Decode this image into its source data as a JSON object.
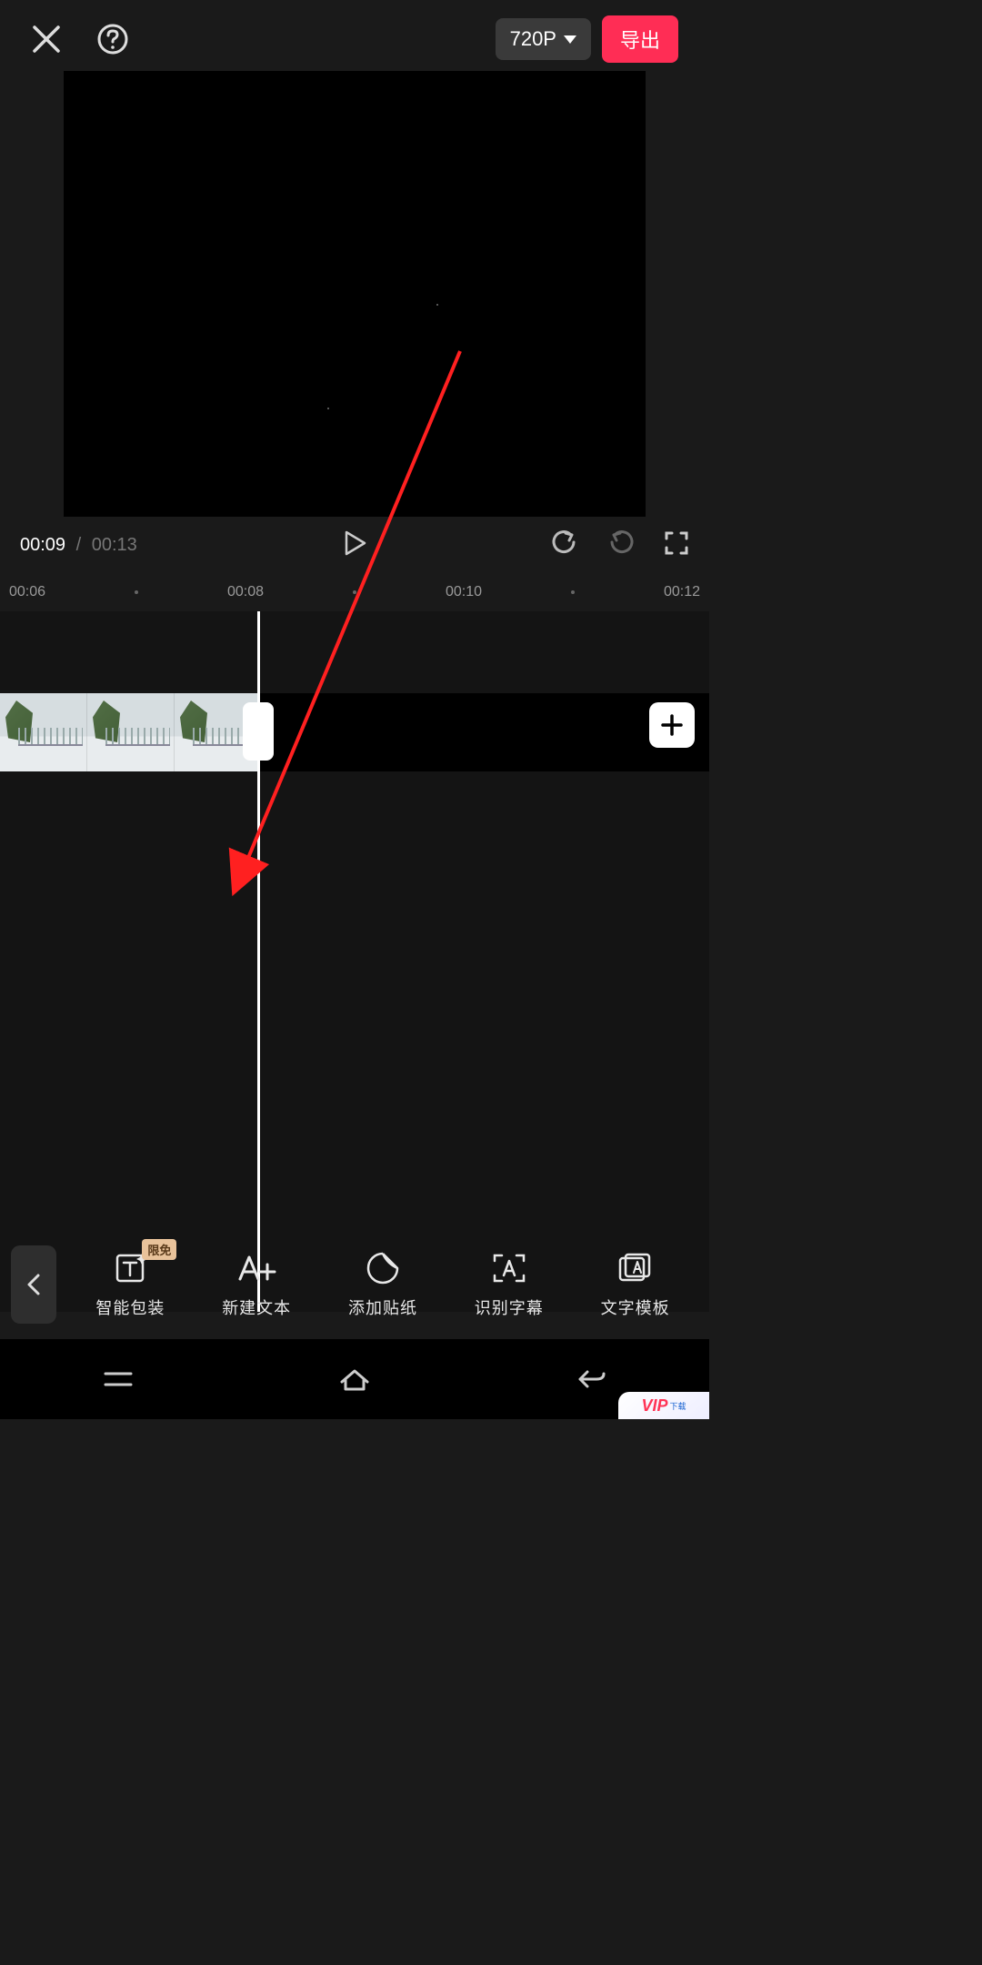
{
  "header": {
    "resolution_label": "720P",
    "export_label": "导出"
  },
  "playback": {
    "current_time": "00:09",
    "separator": "/",
    "duration": "00:13"
  },
  "ruler": {
    "marks": [
      "00:06",
      "00:08",
      "00:10",
      "00:12"
    ]
  },
  "toolbar": {
    "items": [
      {
        "label": "智能包装",
        "badge": "限免",
        "icon": "text-sparkle-icon"
      },
      {
        "label": "新建文本",
        "badge": null,
        "icon": "text-add-icon"
      },
      {
        "label": "添加贴纸",
        "badge": null,
        "icon": "sticker-icon"
      },
      {
        "label": "识别字幕",
        "badge": null,
        "icon": "caption-detect-icon"
      },
      {
        "label": "文字模板",
        "badge": null,
        "icon": "text-template-icon"
      }
    ]
  },
  "watermark": {
    "brand": "VIP",
    "tag": "下载"
  }
}
